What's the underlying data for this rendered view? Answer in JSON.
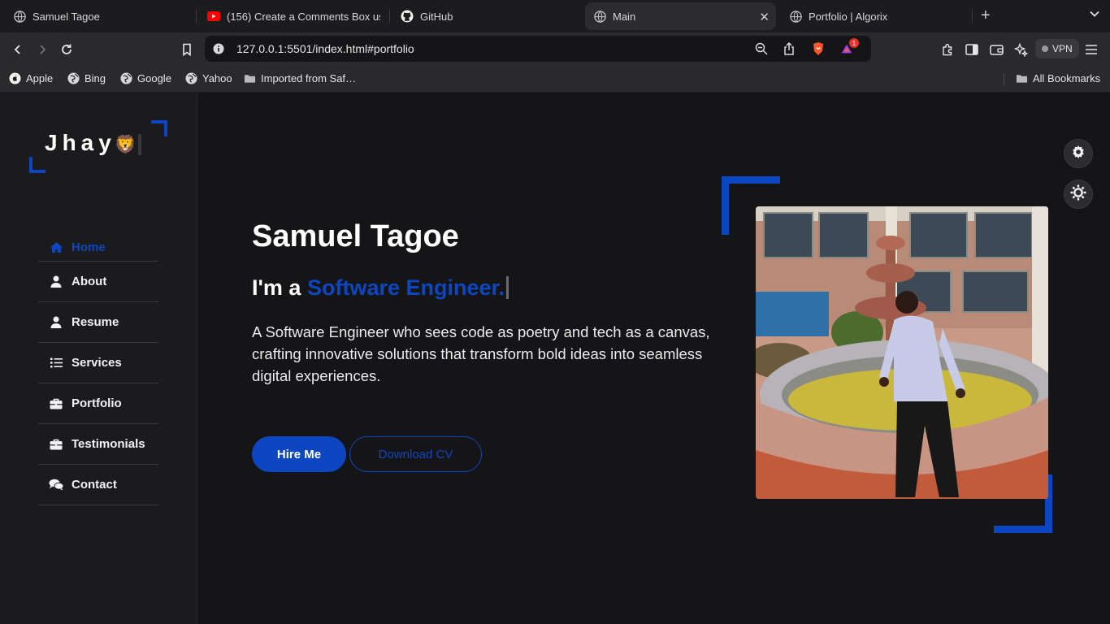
{
  "browser": {
    "tabs": [
      {
        "title": "Samuel Tagoe",
        "icon": "globe-icon"
      },
      {
        "title": "(156) Create a Comments Box usi",
        "icon": "youtube-icon"
      },
      {
        "title": "GitHub",
        "icon": "github-icon"
      },
      {
        "title": "Main",
        "icon": "globe-icon",
        "active": true
      },
      {
        "title": "Portfolio | Algorix",
        "icon": "globe-icon"
      }
    ],
    "url": "127.0.0.1:5501/index.html#portfolio",
    "shields_badge": "1",
    "vpn_label": "VPN",
    "bookmarks": [
      {
        "label": "Apple",
        "icon": "apple-icon"
      },
      {
        "label": "Bing",
        "icon": "globe-icon"
      },
      {
        "label": "Google",
        "icon": "globe-icon"
      },
      {
        "label": "Yahoo",
        "icon": "globe-icon"
      },
      {
        "label": "Imported from Saf…",
        "icon": "folder-icon"
      }
    ],
    "all_bookmarks": "All Bookmarks"
  },
  "sidebar": {
    "logo_text": "Jhay",
    "logo_emoji": "🦁",
    "nav": [
      {
        "label": "Home",
        "icon": "home-icon",
        "active": true
      },
      {
        "label": "About",
        "icon": "user-icon"
      },
      {
        "label": "Resume",
        "icon": "user-icon"
      },
      {
        "label": "Services",
        "icon": "list-icon"
      },
      {
        "label": "Portfolio",
        "icon": "briefcase-icon"
      },
      {
        "label": "Testimonials",
        "icon": "briefcase-icon"
      },
      {
        "label": "Contact",
        "icon": "comments-icon"
      }
    ]
  },
  "hero": {
    "name": "Samuel Tagoe",
    "role_prefix": "I'm a ",
    "role_accent": "Software Engineer.",
    "description": "A Software Engineer who sees code as poetry and tech as a canvas, crafting innovative solutions that transform bold ideas into seamless digital experiences.",
    "hire_label": "Hire Me",
    "cv_label": "Download CV"
  },
  "colors": {
    "accent": "#0c46c0",
    "page_bg": "#151517",
    "sidebar_bg": "#1b1b1d"
  }
}
